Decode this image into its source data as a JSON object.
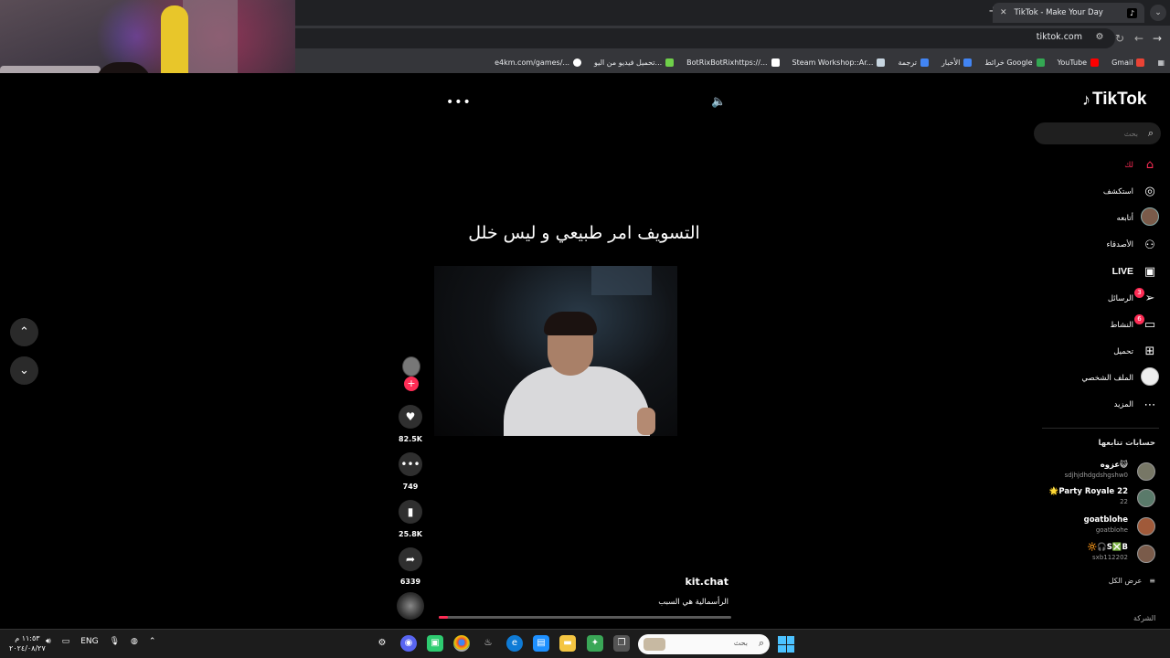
{
  "browser": {
    "tab_title": "TikTok - Make Your Day",
    "url": "tiktok.com",
    "bookmarks": [
      {
        "label": "Gmail",
        "color": "#ea4335"
      },
      {
        "label": "YouTube",
        "color": "#ff0000"
      },
      {
        "label": "خرائط Google",
        "color": "#34a853"
      },
      {
        "label": "الأخبار",
        "color": "#4285f4"
      },
      {
        "label": "ترجمة",
        "color": "#4285f4"
      },
      {
        "label": "Steam Workshop::Ar...",
        "color": "#1b2838"
      },
      {
        "label": "BotRixBotRixhttps://...",
        "color": "#ffffff"
      },
      {
        "label": "تحميل فيديو من اليو...",
        "color": "#6fd04a"
      },
      {
        "label": "e4km.com/games/...",
        "color": "#ffffff"
      }
    ]
  },
  "video": {
    "caption_overlay": "التسويف امر طبيعي و ليس خلل",
    "author": "kit.chat",
    "description": "الرأسمالية هي السبب",
    "progress": 0.03,
    "likes": "82.5K",
    "comments": "749",
    "saves": "25.8K",
    "shares": "6339"
  },
  "sidebar": {
    "logo": "TikTok",
    "search_placeholder": "بحث",
    "nav": [
      {
        "label": "لك",
        "icon": "home-icon",
        "glyph": "⌂",
        "active": true,
        "badge": ""
      },
      {
        "label": "استكشف",
        "icon": "compass-icon",
        "glyph": "◎",
        "active": false,
        "badge": ""
      },
      {
        "label": "أتابعه",
        "icon": "avatar-icon",
        "glyph": "",
        "active": false,
        "badge": ""
      },
      {
        "label": "الأصدقاء",
        "icon": "friends-icon",
        "glyph": "👥",
        "active": false,
        "badge": ""
      },
      {
        "label": "LIVE",
        "icon": "live-icon",
        "glyph": "▣",
        "active": false,
        "badge": ""
      },
      {
        "label": "الرسائل",
        "icon": "messages-icon",
        "glyph": "➢",
        "active": false,
        "badge": "3"
      },
      {
        "label": "النشاط",
        "icon": "activity-icon",
        "glyph": "▭",
        "active": false,
        "badge": "6"
      },
      {
        "label": "تحميل",
        "icon": "upload-icon",
        "glyph": "⊞",
        "active": false,
        "badge": ""
      },
      {
        "label": "الملف الشخصي",
        "icon": "profile-icon",
        "glyph": "",
        "active": false,
        "badge": ""
      },
      {
        "label": "المزيد",
        "icon": "more-icon",
        "glyph": "⋯",
        "active": false,
        "badge": ""
      }
    ],
    "following_title": "حسابات تتابعها",
    "following": [
      {
        "name": "عزوه😺",
        "handle": "sdjhjdhdgdshgshw0"
      },
      {
        "name": "🌟Party Royale 22",
        "handle": "22"
      },
      {
        "name": "goatblohe",
        "handle": "goatblohe"
      },
      {
        "name": "🔆🎧S❎B",
        "handle": "sxb112202"
      }
    ],
    "see_all": "عرض الكل",
    "footer": "الشركة"
  },
  "taskbar": {
    "time": "١١:٥٣ م",
    "date": "٢٠٢٤/٠٨/٢٧",
    "language": "ENG",
    "search_placeholder": "بحث"
  },
  "colors": {
    "accent": "#fe2c55",
    "background": "#000000",
    "chrome_dark": "#202124",
    "chrome_toolbar": "#35363a"
  }
}
